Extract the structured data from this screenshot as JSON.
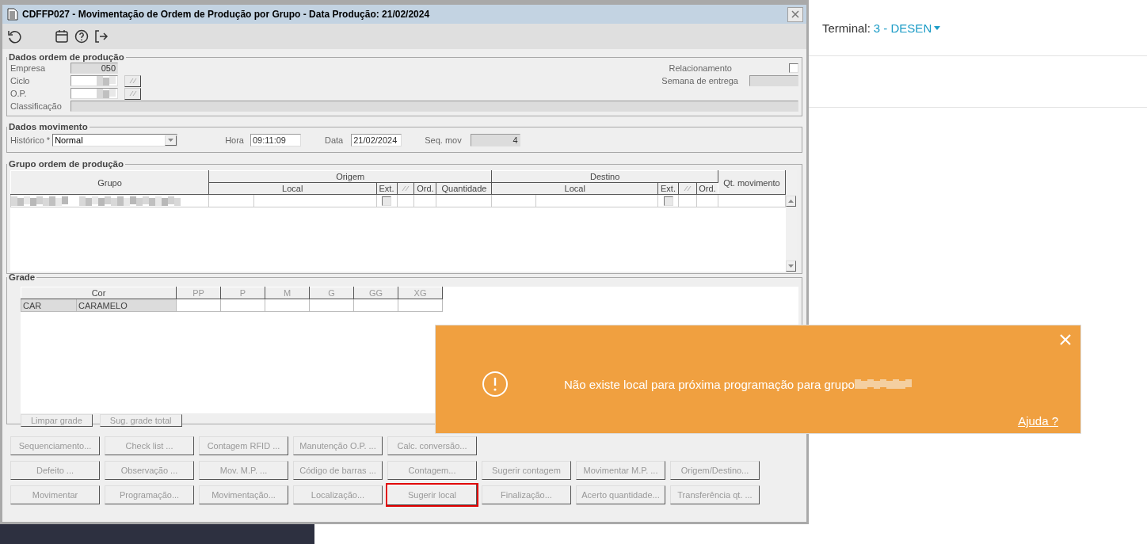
{
  "window": {
    "title": "CDFFP027 - Movimentação de Ordem de Produção por Grupo - Data Produção: 21/02/2024"
  },
  "dados_ordem": {
    "title": "Dados ordem de produção",
    "fields": [
      {
        "label": "Empresa",
        "value": "050",
        "kind": "readonly"
      },
      {
        "label": "Ciclo",
        "kind": "lookup"
      },
      {
        "label": "O.P.",
        "kind": "lookup"
      },
      {
        "label": "Classificação",
        "kind": "wide"
      }
    ],
    "relacionamento": {
      "label": "Relacionamento",
      "checked": false
    },
    "semana": {
      "label": "Semana de entrega"
    }
  },
  "dados_movimento": {
    "title": "Dados movimento",
    "historico": {
      "label": "Histórico *",
      "value": "Normal"
    },
    "hora": {
      "label": "Hora",
      "value": "09:11:09"
    },
    "data": {
      "label": "Data",
      "value": "21/02/2024"
    },
    "seq": {
      "label": "Seq. mov",
      "value": "4"
    }
  },
  "grupo": {
    "title": "Grupo ordem de produção",
    "grupo_header": "Grupo",
    "origem": "Origem",
    "destino": "Destino",
    "qt_header": "Qt. movimento",
    "origem_columns": [
      "Local",
      "Ext.",
      "Ord.",
      "Quantidade"
    ],
    "destino_columns": [
      "Local",
      "Ext.",
      "Ord."
    ],
    "rows": [
      {
        "origem_ext_checked": false,
        "destino_ext_checked": false
      }
    ]
  },
  "grade": {
    "title": "Grade",
    "columns": [
      "Cor",
      "PP",
      "P",
      "M",
      "G",
      "GG",
      "XG"
    ],
    "rows": [
      {
        "code": "CAR",
        "name": "CARAMELO"
      }
    ],
    "buttons": [
      {
        "label": "Limpar grade",
        "disabled": true
      },
      {
        "label": "Sug. grade total",
        "disabled": true
      }
    ]
  },
  "action_rows": [
    {
      "buttons": [
        {
          "label": "Sequenciamento...",
          "disabled": true,
          "highlighted": false
        },
        {
          "label": "Check list ...",
          "disabled": true,
          "highlighted": false
        },
        {
          "label": "Contagem RFID ...",
          "disabled": true,
          "highlighted": false
        },
        {
          "label": "Manutenção O.P. ...",
          "disabled": true,
          "highlighted": false
        },
        {
          "label": "Calc. conversão...",
          "disabled": true,
          "highlighted": false
        }
      ]
    },
    {
      "buttons": [
        {
          "label": "Defeito ...",
          "disabled": true,
          "highlighted": false
        },
        {
          "label": "Observação ...",
          "disabled": true,
          "highlighted": false
        },
        {
          "label": "Mov. M.P. ...",
          "disabled": true,
          "highlighted": false
        },
        {
          "label": "Código de barras ...",
          "disabled": true,
          "highlighted": false
        },
        {
          "label": "Contagem...",
          "disabled": true,
          "highlighted": false
        },
        {
          "label": "Sugerir contagem",
          "disabled": true,
          "highlighted": false
        },
        {
          "label": "Movimentar M.P. ...",
          "disabled": true,
          "highlighted": false
        },
        {
          "label": "Origem/Destino...",
          "disabled": true,
          "highlighted": false
        }
      ]
    },
    {
      "buttons": [
        {
          "label": "Movimentar",
          "disabled": true,
          "highlighted": false
        },
        {
          "label": "Programação...",
          "disabled": true,
          "highlighted": false
        },
        {
          "label": "Movimentação...",
          "disabled": true,
          "highlighted": false
        },
        {
          "label": "Localização...",
          "disabled": true,
          "highlighted": false
        },
        {
          "label": "Sugerir local",
          "disabled": true,
          "highlighted": true
        },
        {
          "label": "Finalização...",
          "disabled": true,
          "highlighted": false
        },
        {
          "label": "Acerto quantidade...",
          "disabled": true,
          "highlighted": false
        },
        {
          "label": "Transferência qt. ...",
          "disabled": true,
          "highlighted": false
        }
      ]
    }
  ],
  "terminal": {
    "label": "Terminal:",
    "value": "3 - DESEN"
  },
  "toast": {
    "message": "Não existe local para próxima programação para grupo",
    "link": "Ajuda ?"
  }
}
